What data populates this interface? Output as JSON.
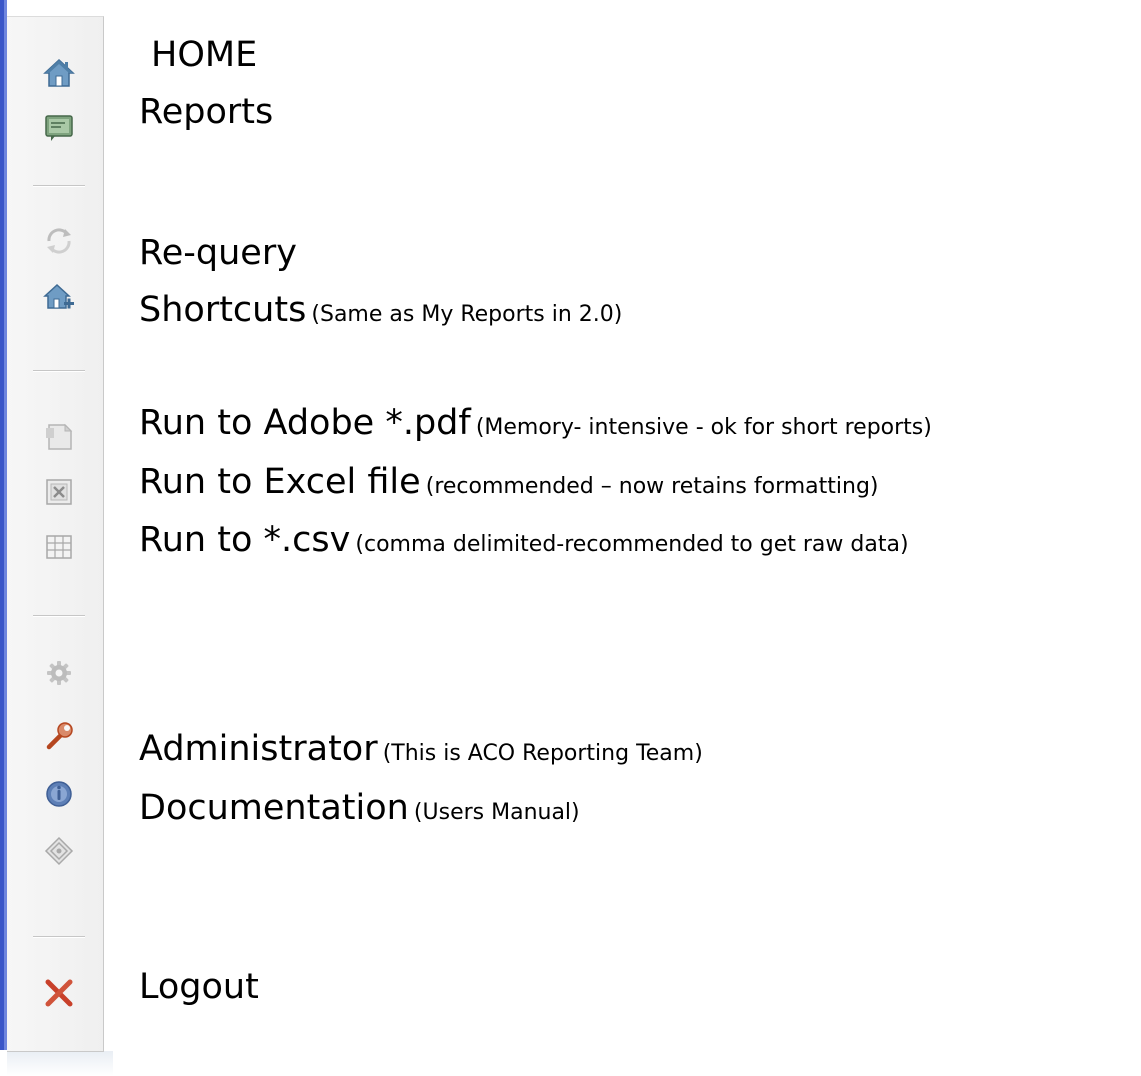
{
  "menu": {
    "home": {
      "label": "HOME",
      "note": ""
    },
    "reports": {
      "label": "Reports",
      "note": ""
    },
    "requery": {
      "label": "Re-query",
      "note": ""
    },
    "shortcuts": {
      "label": "Shortcuts",
      "note": "(Same as My Reports in 2.0)"
    },
    "run_pdf": {
      "label": "Run to Adobe *.pdf",
      "note": "(Memory- intensive - ok for short reports)"
    },
    "run_excel": {
      "label": "Run to Excel file",
      "note": "(recommended – now retains formatting)"
    },
    "run_csv": {
      "label": "Run to *.csv",
      "note": "(comma delimited-recommended to get raw data)"
    },
    "administrator": {
      "label": "Administrator",
      "note": "(This is ACO Reporting Team)"
    },
    "documentation": {
      "label": "Documentation",
      "note": "(Users Manual)"
    },
    "logout": {
      "label": "Logout",
      "note": ""
    }
  },
  "toolbar_icons": [
    "home-icon",
    "reports-icon",
    "requery-icon",
    "shortcuts-icon",
    "pdf-icon",
    "excel-icon",
    "csv-icon",
    "settings-icon",
    "administrator-icon",
    "documentation-icon",
    "about-icon",
    "logout-icon"
  ],
  "colors": {
    "edge_blue": "#3a56c8",
    "home_blue": "#4f7fa8",
    "logout_red": "#c8402a",
    "wrench_red": "#b5461f",
    "disabled_gray": "#b9b9b9"
  }
}
